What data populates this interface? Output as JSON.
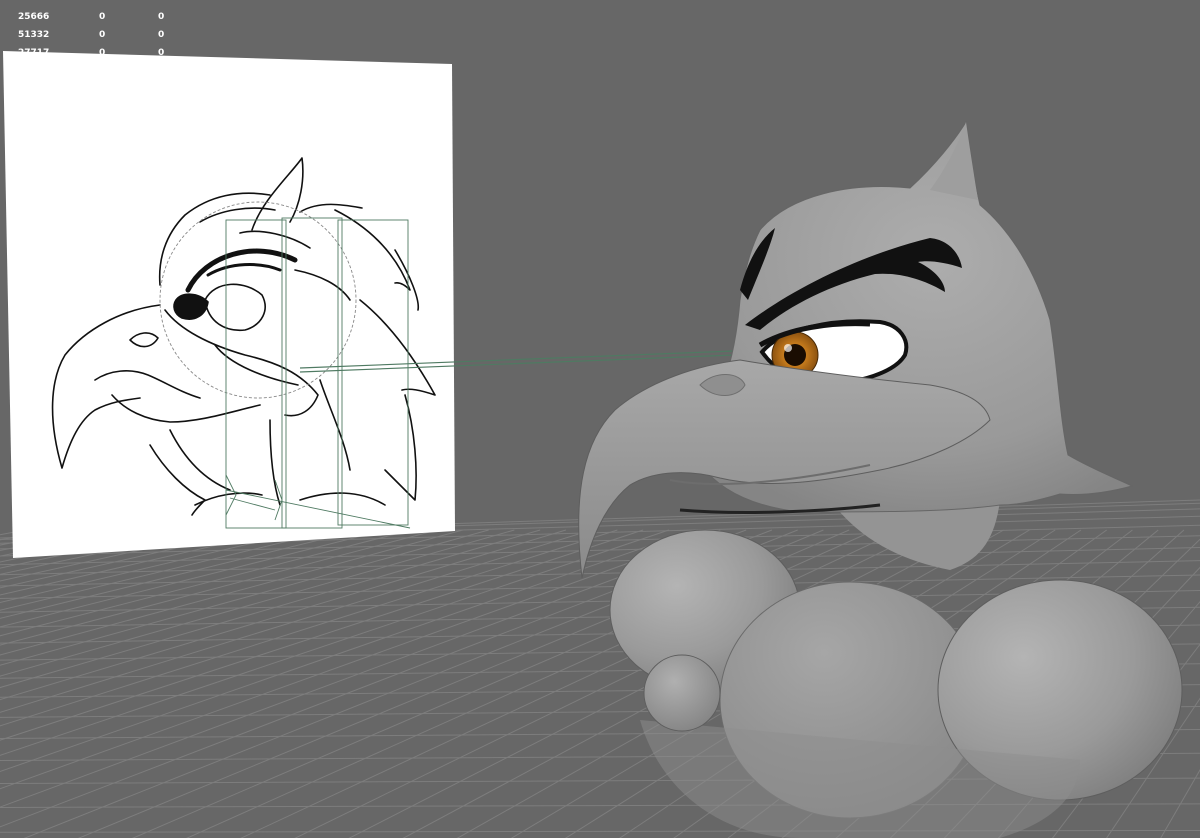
{
  "viewport": {
    "background_color": "#676767",
    "grid_color": "#7d7d7d",
    "image_plane_color": "#ffffff",
    "connector_line_color": "#4f7a62",
    "model_color": "#9c9c9c",
    "eye_iris_color": "#c47a1c"
  },
  "hud": {
    "rows": [
      {
        "c0": "25666",
        "c1": "0",
        "c2": "0"
      },
      {
        "c0": "51332",
        "c1": "0",
        "c2": "0"
      },
      {
        "c0": "27717",
        "c1": "0",
        "c2": "0"
      }
    ]
  },
  "scene": {
    "image_plane": {
      "subject": "eagle-head-line-drawing"
    },
    "model": {
      "subject": "eagle-mascot-3d-model"
    }
  }
}
